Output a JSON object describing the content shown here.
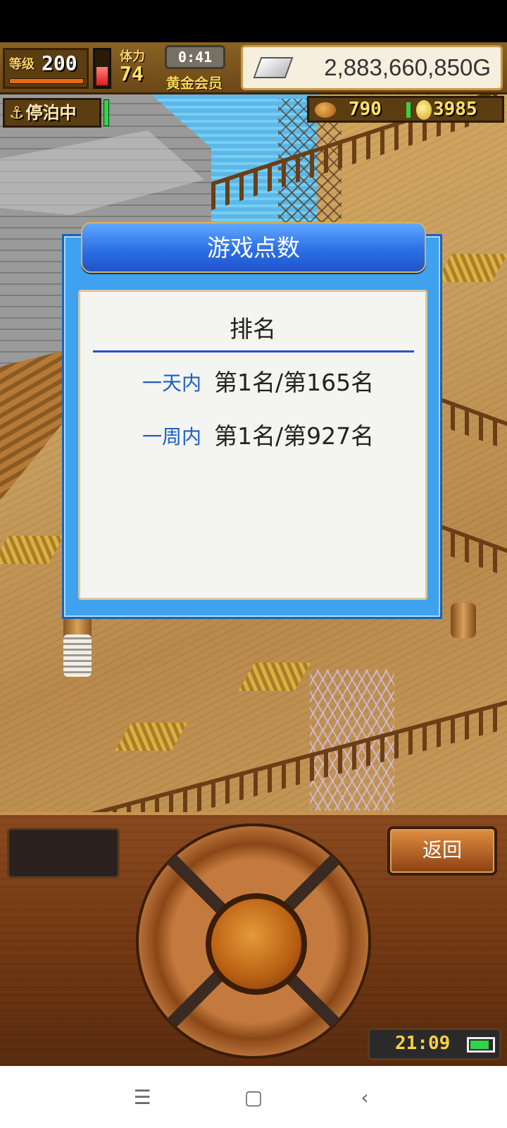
{
  "hud": {
    "level_label": "等级",
    "level_value": "200",
    "stamina_label": "体力",
    "stamina_value": "74",
    "stamina_fill": 0.55,
    "timer": "0:41",
    "membership": "黄金会员",
    "gold": "2,883,660,850G",
    "moor_status": "停泊中",
    "fish_count": "790",
    "coin_count": "3985"
  },
  "dialog": {
    "title": "游戏点数",
    "heading": "排名",
    "rows": [
      {
        "period": "一天内",
        "value": "第1名/第165名"
      },
      {
        "period": "一周内",
        "value": "第1名/第927名"
      }
    ]
  },
  "controls": {
    "back_label": "返回",
    "clock": "21:09",
    "battery_level": 0.85
  },
  "icons": {
    "anchor": "anchor-icon",
    "fish": "fish-icon",
    "coin": "coin-icon",
    "ingot": "silver-ingot-icon",
    "battery": "battery-icon",
    "nav_menu": "menu-icon",
    "nav_home": "home-icon",
    "nav_back": "back-icon"
  },
  "colors": {
    "dialog_blue": "#3ea2ee",
    "header_blue": "#2d6fe6",
    "label_blue": "#1a5fc8",
    "wood": "#8b4a1f"
  }
}
